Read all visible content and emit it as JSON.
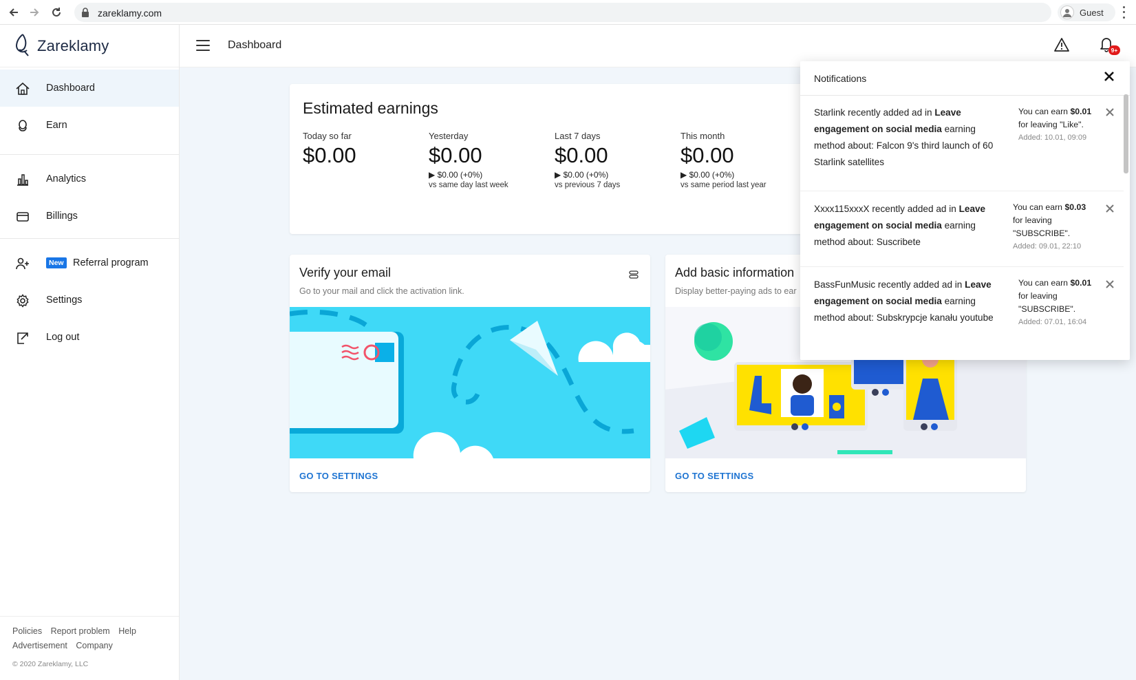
{
  "browser": {
    "url": "zareklamy.com",
    "profile_label": "Guest"
  },
  "app": {
    "brand": "Zareklamy",
    "page_title": "Dashboard",
    "notification_badge": "9+"
  },
  "sidebar": {
    "items": [
      {
        "label": "Dashboard",
        "icon": "home-icon"
      },
      {
        "label": "Earn",
        "icon": "coin-icon"
      },
      {
        "label": "Analytics",
        "icon": "bar-chart-icon"
      },
      {
        "label": "Billings",
        "icon": "card-icon"
      },
      {
        "label": "Referral program",
        "icon": "add-user-icon",
        "badge": "New"
      },
      {
        "label": "Settings",
        "icon": "gear-icon"
      },
      {
        "label": "Log out",
        "icon": "logout-icon"
      }
    ],
    "footer_links": [
      "Policies",
      "Report problem",
      "Help",
      "Advertisement",
      "Company"
    ],
    "copyright": "© 2020 Zareklamy, LLC"
  },
  "earnings": {
    "title": "Estimated earnings",
    "stats": [
      {
        "label": "Today so far",
        "value": "$0.00",
        "change": "",
        "compare": ""
      },
      {
        "label": "Yesterday",
        "value": "$0.00",
        "change": "▶ $0.00 (+0%)",
        "compare": "vs same day last week"
      },
      {
        "label": "Last 7 days",
        "value": "$0.00",
        "change": "▶ $0.00 (+0%)",
        "compare": "vs previous 7 days"
      },
      {
        "label": "This month",
        "value": "$0.00",
        "change": "▶ $0.00 (+0%)",
        "compare": "vs same period last year"
      }
    ]
  },
  "tasks": [
    {
      "title": "Verify your email",
      "subtitle": "Go to your mail and click the activation link.",
      "link": "GO TO SETTINGS"
    },
    {
      "title": "Add basic information",
      "subtitle": "Display better-paying ads to ear",
      "link": "GO TO SETTINGS"
    }
  ],
  "notifications": {
    "title": "Notifications",
    "items": [
      {
        "advertiser": "Starlink",
        "msg_mid": " recently added ad in ",
        "method": "Leave engagement on social media",
        "msg_tail": " earning method about: Falcon 9's third launch of 60 Starlink satellites",
        "earn_prefix": "You can earn ",
        "amount": "$0.01",
        "action": " for leaving \"Like\".",
        "added": "Added: 10.01, 09:09"
      },
      {
        "advertiser": "Xxxx115xxxX",
        "msg_mid": " recently added ad in ",
        "method": "Leave engagement on social media",
        "msg_tail": " earning method about: Suscribete",
        "earn_prefix": "You can earn ",
        "amount": "$0.03",
        "action": " for leaving \"SUBSCRIBE\".",
        "added": "Added: 09.01, 22:10"
      },
      {
        "advertiser": "BassFunMusic",
        "msg_mid": " recently added ad in ",
        "method": "Leave engagement on social media",
        "msg_tail": " earning method about: Subskrypcje kanału youtube",
        "earn_prefix": "You can earn ",
        "amount": "$0.01",
        "action": " for leaving \"SUBSCRIBE\".",
        "added": "Added: 07.01, 16:04"
      }
    ]
  },
  "colors": {
    "accent": "#1e74d2",
    "badge_red": "#e21b1b",
    "illus_cyan": "#3fd9f7",
    "main_bg": "#f1f6fb"
  }
}
